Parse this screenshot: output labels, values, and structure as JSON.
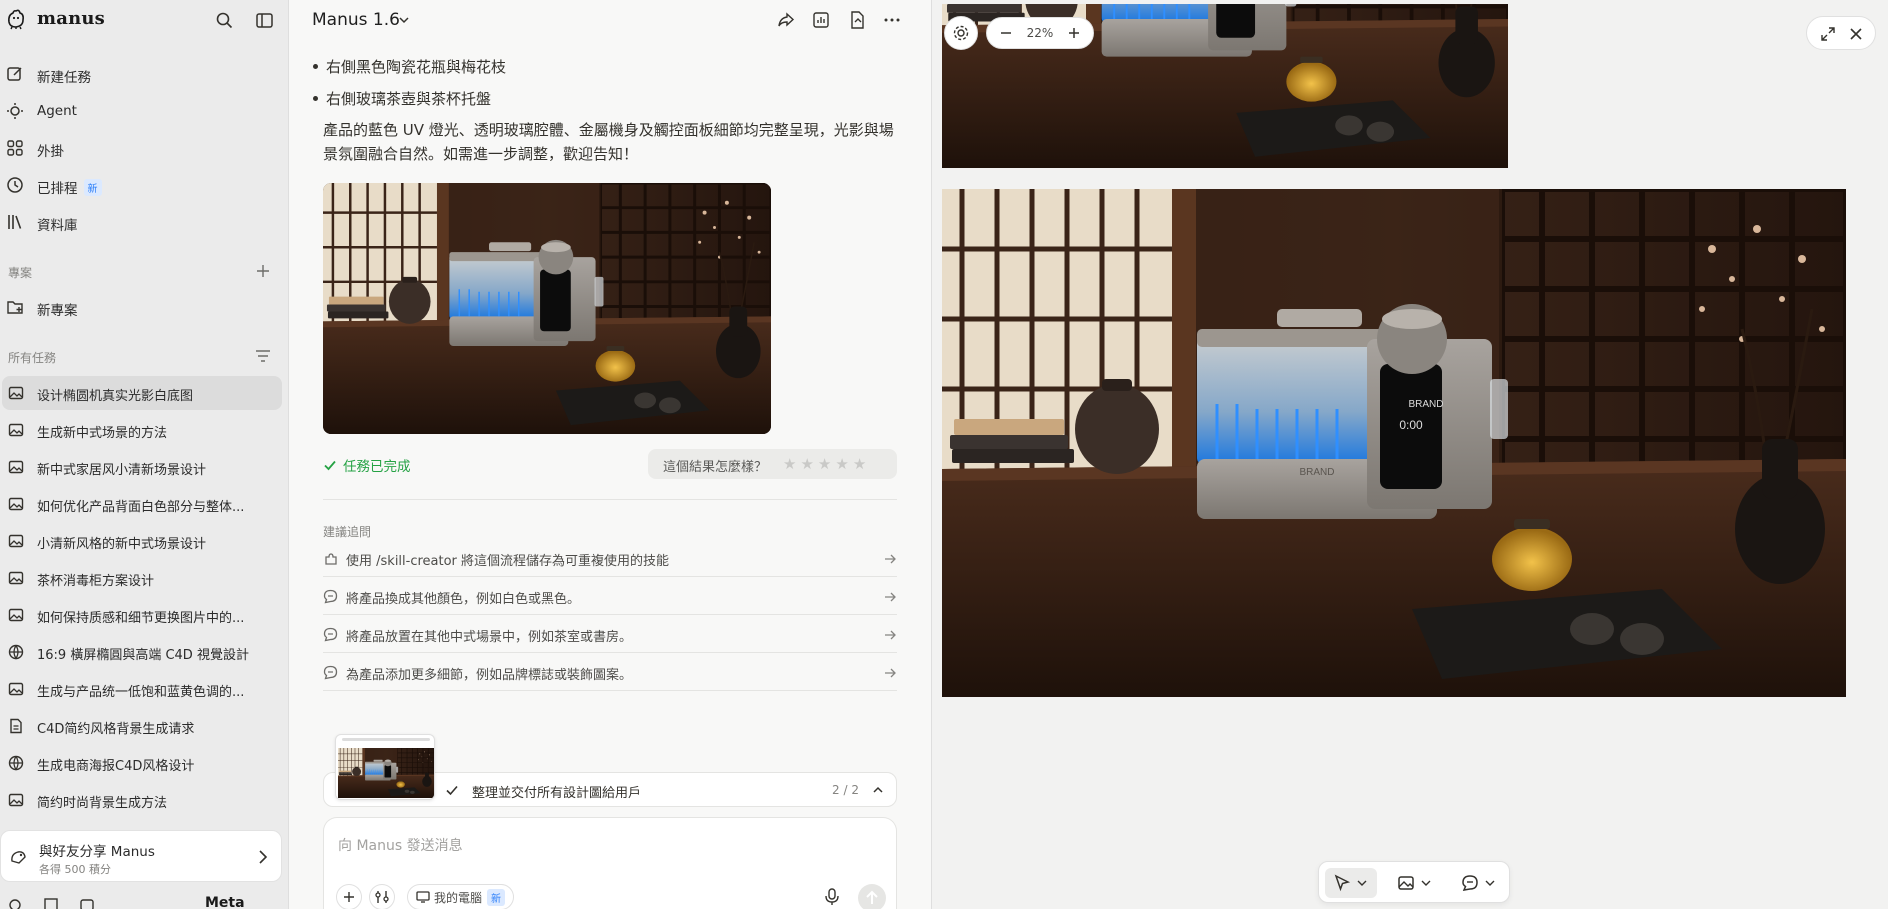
{
  "sidebar": {
    "brand": "manus",
    "nav": [
      {
        "label": "新建任務",
        "icon": "edit-icon"
      },
      {
        "label": "Agent",
        "icon": "agent-icon"
      },
      {
        "label": "外掛",
        "icon": "plugin-icon"
      },
      {
        "label": "已排程",
        "icon": "clock-icon",
        "badge": "新"
      },
      {
        "label": "資料庫",
        "icon": "library-icon"
      }
    ],
    "projects_title": "專案",
    "new_project": "新專案",
    "tasks_title": "所有任務",
    "tasks": [
      {
        "label": "设计椭圆机真实光影白底图",
        "icon": "image-icon",
        "active": true
      },
      {
        "label": "生成新中式场景的方法",
        "icon": "image-icon"
      },
      {
        "label": "新中式家居风小清新场景设计",
        "icon": "image-icon"
      },
      {
        "label": "如何优化产品背面白色部分与整体...",
        "icon": "image-icon"
      },
      {
        "label": "小清新风格的新中式场景设计",
        "icon": "image-icon"
      },
      {
        "label": "茶杯消毒柜方案设计",
        "icon": "image-icon"
      },
      {
        "label": "如何保持质感和细节更换图片中的...",
        "icon": "image-icon"
      },
      {
        "label": "16:9 橫屏橢圓與高端 C4D 視覺設計",
        "icon": "globe-icon"
      },
      {
        "label": "生成与产品统一低饱和蓝黄色调的...",
        "icon": "image-icon"
      },
      {
        "label": "C4D简约风格背景生成请求",
        "icon": "document-icon"
      },
      {
        "label": "生成电商海报C4D风格设计",
        "icon": "globe-icon"
      },
      {
        "label": "简约时尚背景生成方法",
        "icon": "image-icon"
      }
    ],
    "share": {
      "title": "與好友分享 Manus",
      "subtitle": "各得 500 積分"
    },
    "footer_text": "Meta"
  },
  "chat": {
    "title": "Manus 1.6",
    "bullets": [
      "右側黑色陶瓷花瓶與梅花枝",
      "右側玻璃茶壺與茶杯托盤"
    ],
    "paragraph": "產品的藍色 UV 燈光、透明玻璃腔體、金屬機身及觸控面板細節均完整呈現，光影與場景氛圍融合自然。如需進一步調整，歡迎告知！",
    "status": "任務已完成",
    "rating_question": "這個結果怎麼樣？",
    "rating_stars": 0,
    "suggest_label": "建議追問",
    "suggestions": [
      {
        "label": "使用 /skill-creator 將這個流程儲存為可重複使用的技能",
        "icon": "puzzle-icon"
      },
      {
        "label": "將產品換成其他顏色，例如白色或黑色。",
        "icon": "chat-bubble-icon"
      },
      {
        "label": "將產品放置在其他中式場景中，例如茶室或書房。",
        "icon": "chat-bubble-icon"
      },
      {
        "label": "為產品添加更多細節，例如品牌標誌或裝飾圖案。",
        "icon": "chat-bubble-icon"
      }
    ],
    "task_progress": {
      "label": "整理並交付所有設計圖給用戶",
      "count": "2 / 2"
    },
    "composer": {
      "placeholder": "向 Manus 發送消息",
      "pc_label": "我的電腦",
      "pc_badge": "新"
    }
  },
  "preview": {
    "zoom": "22%",
    "product_brand": "BRAND",
    "panel_display": "0:00"
  },
  "colors": {
    "accent_blue": "#2d7ff9",
    "success_green": "#25a244",
    "sidebar_bg": "#ebebeb"
  }
}
